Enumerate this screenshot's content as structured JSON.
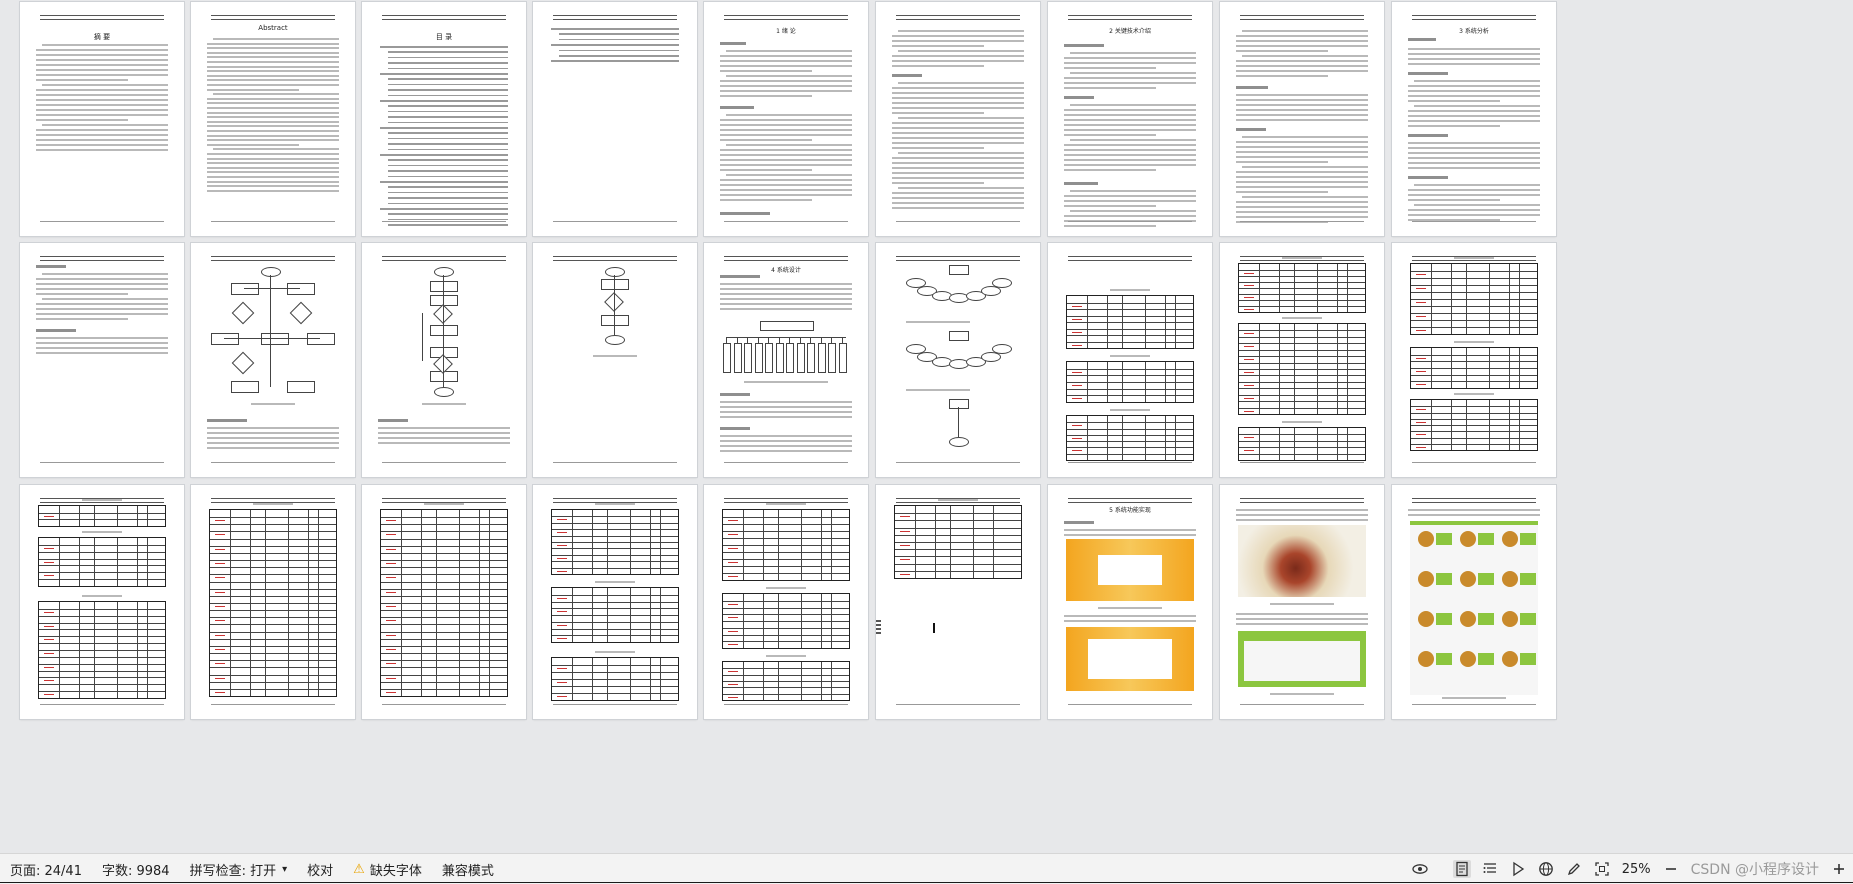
{
  "document": {
    "abstract_title_cn": "摘 要",
    "abstract_title_en": "Abstract",
    "toc_title": "目 录",
    "chapter_intro": "1 绪 论",
    "chapter_tech": "2 关键技术介绍",
    "chapter_analysis": "3 系统分析",
    "chapter_design": "4 系统设计",
    "chapter_impl": "5 系统功能实现"
  },
  "statusbar": {
    "page_label": "页面: 24/41",
    "word_count": "字数: 9984",
    "spellcheck": "拼写检查: 打开",
    "proofread": "校对",
    "missing_font": "缺失字体",
    "compat_mode": "兼容模式",
    "zoom": "25%",
    "watermark": "CSDN @小程序设计"
  },
  "colors": {
    "accent_warning": "#e8a300",
    "page_bg": "#ffffff",
    "canvas_bg": "#e7e8ea",
    "banner_orange": "#f3a51f",
    "banner_green": "#8cc63f"
  },
  "icons": [
    "eye-icon",
    "page-view-icon",
    "outline-icon",
    "play-icon",
    "globe-icon",
    "pen-icon",
    "fit-page-icon",
    "zoom-out-icon",
    "zoom-in-icon",
    "warning-icon",
    "chevron-down-icon"
  ]
}
